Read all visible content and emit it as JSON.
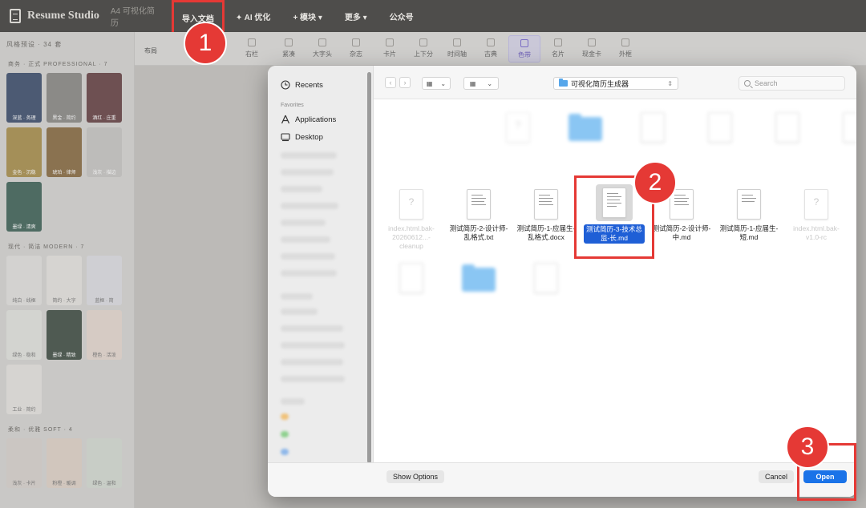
{
  "app": {
    "brand": "Resume Studio",
    "subtitle": "A4 可视化简历",
    "nav": {
      "import": "导入文档",
      "ai": "✦ AI 优化",
      "modules": "+ 模块 ▾",
      "more": "更多 ▾",
      "official": "公众号"
    }
  },
  "sidebar": {
    "title": "风格预设 · 34 套",
    "sections": {
      "business": "商务 · 正式  PROFESSIONAL · 7",
      "modern": "现代 · 简洁  MODERN · 7",
      "soft": "柔和 · 优雅  SOFT · 4"
    },
    "thumbs": [
      "深蓝 · 务理",
      "黑金 · 简约",
      "酒红 · 庄重",
      "金色 · 沉稳",
      "琥珀 · 律师",
      "浅灰 · 描边",
      "墨绿 · 清爽",
      "纯白 · 线框",
      "简约 · 大字",
      "蓝框 · 简",
      "绿色 · 稳和",
      "墨绿 · 精致",
      "橙色 · 活泼",
      "工业 · 简约",
      "浅灰 · 卡片",
      "粉橙 · 暖调",
      "绿色 · 温和"
    ]
  },
  "toolbar": {
    "label": "布局",
    "items": [
      "右栏",
      "紧凑",
      "大字头",
      "杂志",
      "卡片",
      "上下分",
      "时间轴",
      "古典",
      "色带",
      "名片",
      "现金卡",
      "外框"
    ],
    "active_index": 8
  },
  "dialog": {
    "sidebar": {
      "recents": "Recents",
      "favorites_title": "Favorites",
      "applications": "Applications",
      "desktop": "Desktop"
    },
    "toolbar": {
      "back": "‹",
      "forward": "›",
      "folder": "可视化简历生成器",
      "search_placeholder": "Search"
    },
    "files": {
      "f1": "index.html.bak-20260612...-cleanup",
      "f2": "测试简历-2-设计师-乱格式.txt",
      "f3": "测试简历-1-应届生-乱格式.docx",
      "f4": "测试简历-3-技术总监-长.md",
      "f5": "测试简历-2-设计师-中.md",
      "f6": "测试简历-1-应届生-短.md",
      "f7": "index.html.bak-v1.0-rc"
    },
    "buttons": {
      "show_options": "Show Options",
      "cancel": "Cancel",
      "open": "Open"
    }
  },
  "annotations": {
    "step1": "1",
    "step2": "2",
    "step3": "3",
    "color": "#e53935"
  }
}
